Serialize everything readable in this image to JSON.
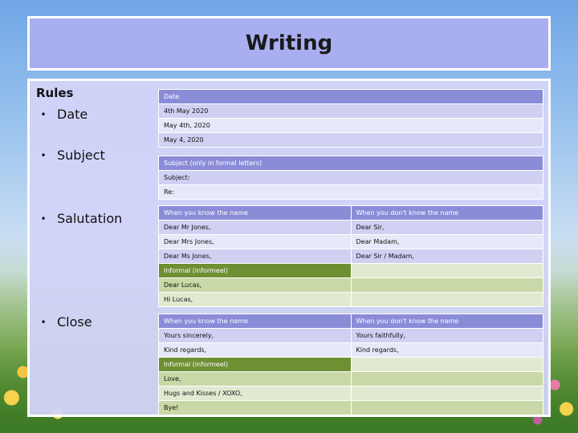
{
  "slide_title": "Writing",
  "rules_title": "Rules",
  "bullets": [
    {
      "symbol": "•",
      "label": "Date"
    },
    {
      "symbol": "•",
      "label": "Subject"
    },
    {
      "symbol": "•",
      "label": "Salutation"
    },
    {
      "symbol": "•",
      "label": "Close"
    }
  ],
  "date_table": {
    "header": "Date",
    "rows": [
      "4th May 2020",
      "May 4th, 2020",
      "May 4, 2020"
    ]
  },
  "subject_table": {
    "header": "Subject (only in formal letters)",
    "rows": [
      "Subject:",
      "Re:"
    ]
  },
  "salutation_table": {
    "col1_header": "When you know the name",
    "col2_header": "When you don't know the name",
    "rows": [
      [
        "Dear Mr Jones,",
        "Dear Sir,"
      ],
      [
        "Dear Mrs Jones,",
        "Dear Madam,"
      ],
      [
        "Dear Ms Jones,",
        "Dear Sir / Madam,"
      ]
    ],
    "informal_header": "Informal (informeel)",
    "informal_rows": [
      "Dear Lucas,",
      "Hi Lucas,"
    ]
  },
  "close_table": {
    "col1_header": "When you know the name",
    "col2_header": "When you don't know the name",
    "rows": [
      [
        "Yours sincerely,",
        "Yours faithfully,"
      ],
      [
        "Kind regards,",
        "Kind regards,"
      ]
    ],
    "informal_header": "Informal (informeel)",
    "informal_rows": [
      "Love,",
      "Hugs and Kisses / XOXO,",
      "Bye!"
    ]
  },
  "colors": {
    "title_bg": "#a9aef0",
    "header_purple": "#8b8cd8",
    "header_green": "#6f8f33"
  }
}
